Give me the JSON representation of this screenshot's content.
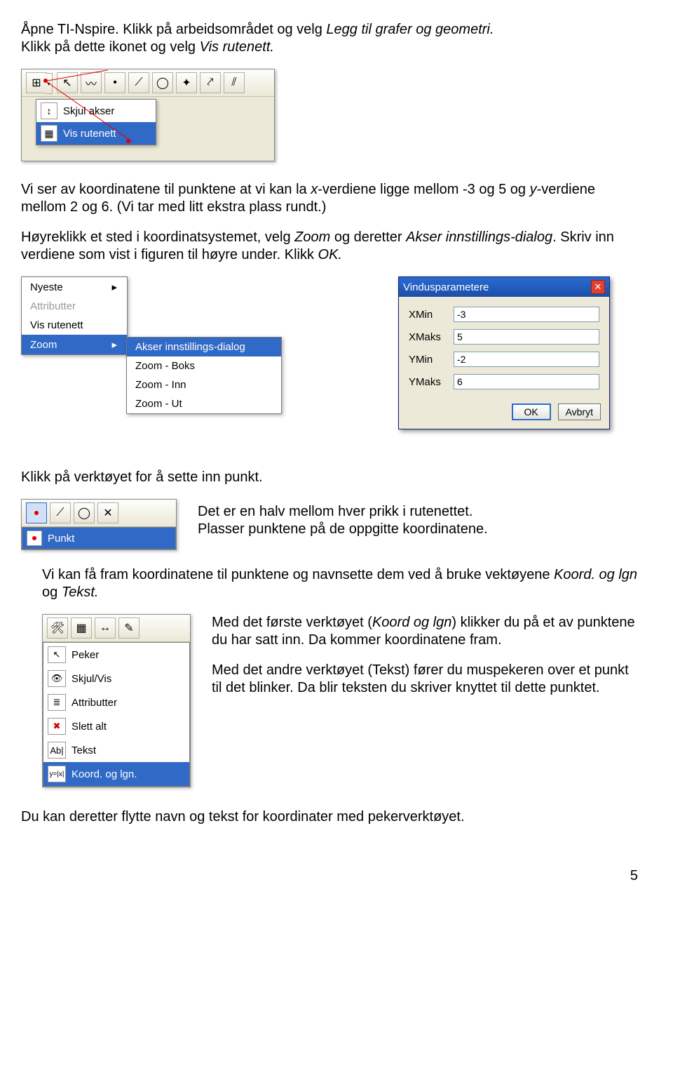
{
  "intro": {
    "p1a": "Åpne TI-Nspire. Klikk på arbeidsområdet og velg ",
    "p1b": "Legg til grafer og geometri.",
    "p2a": "Klikk på dette ikonet og velg ",
    "p2b": "Vis rutenett."
  },
  "menu1": {
    "item1": "Skjul akser",
    "item2": "Vis rutenett"
  },
  "para2": {
    "a": "Vi ser av koordinatene til punktene at vi kan la ",
    "b": "x",
    "c": "-verdiene ligge mellom -3 og 5 og ",
    "d": "y",
    "e": "-verdiene mellom 2 og 6. (Vi tar med litt ekstra plass rundt.)"
  },
  "para3": {
    "a": "Høyreklikk et sted i koordinatsystemet, velg ",
    "b": "Zoom",
    "c": " og deretter ",
    "d": "Akser innstillings-dialog",
    "e": ". Skriv inn verdiene som vist i figuren til høyre under. Klikk ",
    "f": "OK."
  },
  "ctx": {
    "nyeste": "Nyeste",
    "attributter": "Attributter",
    "visrutenett": "Vis rutenett",
    "zoom": "Zoom"
  },
  "sub": {
    "akser": "Akser innstillings-dialog",
    "boks": "Zoom - Boks",
    "inn": "Zoom - Inn",
    "ut": "Zoom - Ut"
  },
  "dlg": {
    "title": "Vindusparametere",
    "xmin_l": "XMin",
    "xmin_v": "-3",
    "xmaks_l": "XMaks",
    "xmaks_v": "5",
    "ymin_l": "YMin",
    "ymin_v": "-2",
    "ymaks_l": "YMaks",
    "ymaks_v": "6",
    "ok": "OK",
    "avbryt": "Avbryt"
  },
  "para4": "Klikk på verktøyet for å sette inn punkt.",
  "menu3": {
    "punkt": "Punkt"
  },
  "para5": {
    "a": "Det er en halv mellom hver prikk i rutenettet.",
    "b": "Plasser punktene på de oppgitte koordinatene."
  },
  "para6": {
    "a": "Vi kan få fram koordinatene til punktene og navnsette dem ved å bruke vektøyene ",
    "b": "Koord. og lgn ",
    "c": " og ",
    "d": "Tekst."
  },
  "menu4": {
    "peker": "Peker",
    "skjulvis": "Skjul/Vis",
    "attributter": "Attributter",
    "slettalt": "Slett alt",
    "tekst": "Tekst",
    "koord": "Koord. og lgn."
  },
  "para7": {
    "a": "Med det første verktøyet (",
    "b": "Koord og lgn",
    "c": ") klikker du på et av punktene du har satt inn. Da kommer koordinatene fram."
  },
  "para8": "Med det andre verktøyet (Tekst) fører du muspekeren over et punkt til det blinker. Da blir teksten du skriver knyttet til dette punktet.",
  "para9": "Du kan deretter flytte navn og tekst for koordinater med pekerverktøyet.",
  "pagenum": "5"
}
